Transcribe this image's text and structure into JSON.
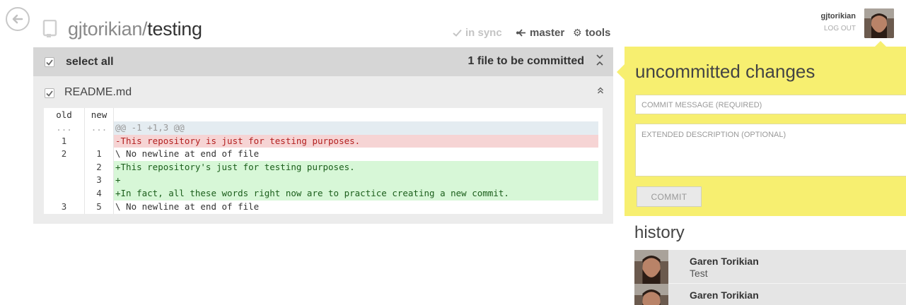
{
  "header": {
    "owner": "gjtorikian/",
    "repo": "testing",
    "sync_status": "in sync",
    "branch": "master",
    "tools": "tools",
    "icons": [
      "back-arrow-icon",
      "repository-icon",
      "check-icon",
      "branch-icon",
      "gear-icon"
    ]
  },
  "user": {
    "name": "gjtorikian",
    "logout": "LOG OUT"
  },
  "changes": {
    "select_all": "select all",
    "count_label": "1 file to be committed",
    "file": {
      "name": "README.md",
      "diff_headers": {
        "old": "old",
        "new": "new"
      },
      "lines": [
        {
          "type": "hunk",
          "old": "...",
          "new": "...",
          "text": "@@ -1 +1,3 @@"
        },
        {
          "type": "del",
          "old": "1",
          "new": "",
          "text": "-This repository is just for testing purposes."
        },
        {
          "type": "ctx",
          "old": "2",
          "new": "1",
          "text": "\\ No newline at end of file"
        },
        {
          "type": "add",
          "old": "",
          "new": "2",
          "text": "+This repository's just for testing purposes."
        },
        {
          "type": "add",
          "old": "",
          "new": "3",
          "text": "+"
        },
        {
          "type": "add",
          "old": "",
          "new": "4",
          "text": "+In fact, all these words right now are to practice creating a new commit."
        },
        {
          "type": "ctx",
          "old": "3",
          "new": "5",
          "text": "\\ No newline at end of file"
        }
      ]
    }
  },
  "commit": {
    "title": "uncommitted changes",
    "message_placeholder": "COMMIT MESSAGE (REQUIRED)",
    "description_placeholder": "EXTENDED DESCRIPTION (OPTIONAL)",
    "button": "COMMIT"
  },
  "history": {
    "title": "history",
    "items": [
      {
        "author": "Garen Torikian",
        "summary": "Test"
      },
      {
        "author": "Garen Torikian",
        "summary": ""
      }
    ]
  },
  "colors": {
    "commit_panel": "#f7ef70",
    "deleted_line": "#f6d4d4",
    "added_line": "#d7f7d7",
    "hunk_line": "#e4ecf1"
  }
}
